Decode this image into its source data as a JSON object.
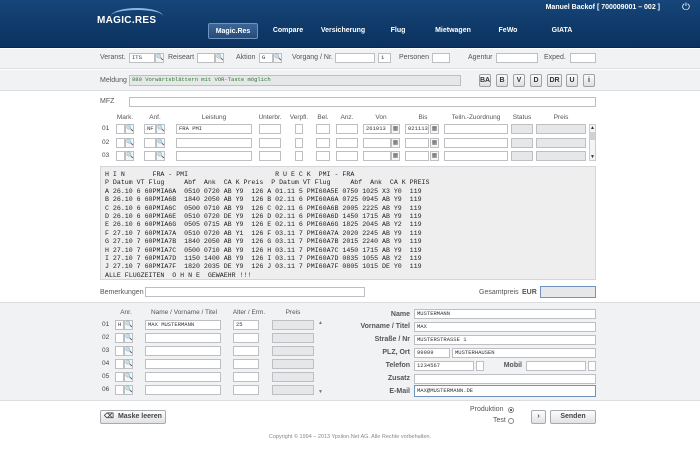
{
  "header": {
    "user": "Manuel Backof [ 700009001 – 002 ]",
    "logo": "MAGIC.RES",
    "nav": [
      "Magic.Res",
      "Compare",
      "Versicherung",
      "Flug",
      "Mietwagen",
      "FeWo",
      "GIATA"
    ]
  },
  "search": {
    "veranst_label": "Veranst.",
    "veranst_value": "ITS",
    "reiseart_label": "Reiseart",
    "aktion_label": "Aktion",
    "aktion_value": "G",
    "vorgang_label": "Vorgang / Nr.",
    "vorgang_nr": "1",
    "personen_label": "Personen",
    "agentur_label": "Agentur",
    "exped_label": "Exped."
  },
  "message": {
    "label": "Meldung",
    "text": "980 Vorwärtsblättern mit VOR-Taste möglich",
    "buttons": [
      "BA",
      "B",
      "V",
      "D",
      "DR",
      "U",
      "i"
    ]
  },
  "mfz": {
    "label": "MFZ"
  },
  "services": {
    "headers": {
      "mark": "Mark.",
      "anf": "Anf.",
      "leistung": "Leistung",
      "unterbr": "Unterbr.",
      "verpfl": "Verpfl.",
      "bel": "Bel.",
      "anz": "Anz.",
      "von": "Von",
      "bis": "Bis",
      "zuordnung": "Teiln.-Zuordnung",
      "status": "Status",
      "preis": "Preis"
    },
    "rows": [
      {
        "nr": "01",
        "anf": "NF",
        "leistung": "FRA PMI",
        "von": "261013",
        "bis": "021113"
      },
      {
        "nr": "02",
        "anf": "",
        "leistung": "",
        "von": "",
        "bis": ""
      },
      {
        "nr": "03",
        "anf": "",
        "leistung": "",
        "von": "",
        "bis": ""
      }
    ]
  },
  "flight_text": "H I N       FRA - PMI                      R U E C K  PMI - FRA\nP Datum VT Flug     Abf  Ank  CA K Preis  P Datum VT Flug     Abf  Ank  CA K PREIS\nA 26.10 6 60PMIA6A  0510 0720 AB Y9  126 A 01.11 5 PMI60A5E 0750 1025 X3 Y0  119\nB 26.10 6 60PMIA6B  1840 2050 AB Y9  126 B 02.11 6 PMI60A6A 0725 0945 AB Y9  119\nC 26.10 6 60PMIA6C  0500 0710 AB Y9  126 C 02.11 6 PMI60A6B 2005 2225 AB Y9  119\nD 26.10 6 60PMIA6E  0510 0720 DE Y9  126 D 02.11 6 PMI60A6D 1450 1715 AB Y9  119\nE 26.10 6 60PMIA6G  0505 0715 AB Y9  126 E 02.11 6 PMI60A6G 1825 2045 AB Y2  119\nF 27.10 7 60PMIA7A  0510 0720 AB Y1  126 F 03.11 7 PMI60A7A 2020 2245 AB Y9  119\nG 27.10 7 60PMIA7B  1840 2050 AB Y9  126 G 03.11 7 PMI60A7B 2015 2240 AB Y9  119\nH 27.10 7 60PMIA7C  0500 0710 AB Y9  126 H 03.11 7 PMI60A7C 1450 1715 AB Y9  119\nI 27.10 7 60PMIA7D  1150 1400 AB Y9  126 I 03.11 7 PMI60A7D 0835 1055 AB Y2  119\nJ 27.10 7 60PMIA7F  1820 2035 DE Y9  126 J 03.11 7 PMI60A7F 0805 1015 DE Y0  119\nALLE FLUGZEITEN  O H N E  GEWAEHR !!!",
  "totals": {
    "bemerkungen_label": "Bemerkungen",
    "gesamtpreis_label": "Gesamtpreis",
    "currency": "EUR"
  },
  "participants": {
    "headers": {
      "anr": "Anr.",
      "name": "Name / Vorname / Titel",
      "alter": "Alter / Erm.",
      "preis": "Preis"
    },
    "rows": [
      {
        "nr": "01",
        "anr": "H",
        "name": "MAX MUSTERMANN",
        "alter": "25"
      },
      {
        "nr": "02",
        "anr": "",
        "name": "",
        "alter": ""
      },
      {
        "nr": "03",
        "anr": "",
        "name": "",
        "alter": ""
      },
      {
        "nr": "04",
        "anr": "",
        "name": "",
        "alter": ""
      },
      {
        "nr": "05",
        "anr": "",
        "name": "",
        "alter": ""
      },
      {
        "nr": "06",
        "anr": "",
        "name": "",
        "alter": ""
      }
    ]
  },
  "customer": {
    "name_label": "Name",
    "name": "MUSTERMANN",
    "vorname_label": "Vorname / Titel",
    "vorname": "MAX",
    "strasse_label": "Straße / Nr",
    "strasse": "MUSTERSTRASSE 1",
    "plz_label": "PLZ, Ort",
    "plz": "99999",
    "ort": "MUSTERHAUSEN",
    "telefon_label": "Telefon",
    "telefon": "1234567",
    "mobil_label": "Mobil",
    "zusatz_label": "Zusatz",
    "email_label": "E-Mail",
    "email": "MAX@MUSTERMANN.DE"
  },
  "footer": {
    "clear_label": "Maske leeren",
    "produktion_label": "Produktion",
    "test_label": "Test",
    "send_label": "Senden",
    "copyright": "Copyright © 1994 – 2013 Ypsilon.Net AG. Alle Rechte vorbehalten."
  }
}
